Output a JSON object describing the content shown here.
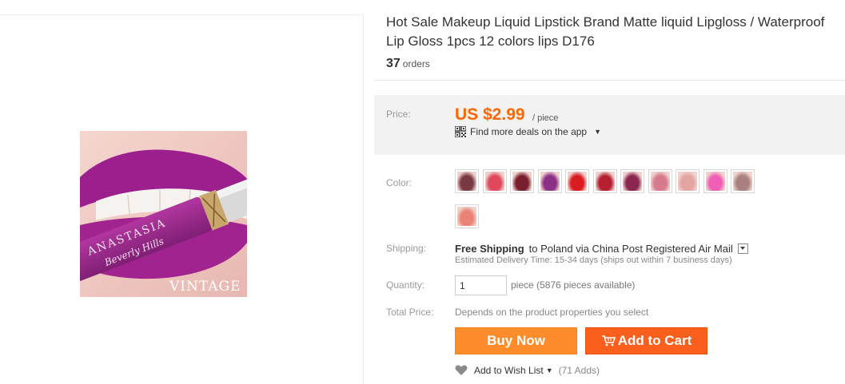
{
  "breadcrumb": {
    "text": ""
  },
  "product": {
    "title_line1": "Hot Sale Makeup Liquid Lipstick Brand Matte liquid Lipgloss / Waterproof",
    "title_line2": "Lip Gloss 1pcs 12 colors lips D176",
    "orders_count": "37",
    "orders_label": "orders",
    "image_text_brand": "ANASTASIA",
    "image_text_sub": "Beverly Hills",
    "image_text_shade": "VINTAGE"
  },
  "price": {
    "label": "Price:",
    "value": "US $2.99",
    "unit": "/ piece",
    "deals_text": "Find more deals on the app"
  },
  "color": {
    "label": "Color:",
    "swatches": [
      {
        "name": "model-1",
        "hex": "#7a3a44"
      },
      {
        "name": "pink-red",
        "hex": "#e0485e"
      },
      {
        "name": "wine",
        "hex": "#7a1e2e"
      },
      {
        "name": "purple",
        "hex": "#8c2f86"
      },
      {
        "name": "red",
        "hex": "#d91b22"
      },
      {
        "name": "model-2",
        "hex": "#b51f30"
      },
      {
        "name": "plum",
        "hex": "#8b2650"
      },
      {
        "name": "rose",
        "hex": "#d77a8e"
      },
      {
        "name": "nude-pink",
        "hex": "#e4a5a2"
      },
      {
        "name": "hot-pink",
        "hex": "#ef5fb6"
      },
      {
        "name": "mauve",
        "hex": "#a9817f"
      },
      {
        "name": "coral",
        "hex": "#ea8275"
      }
    ]
  },
  "shipping": {
    "label": "Shipping:",
    "free": "Free Shipping",
    "dest": "to  Poland via China Post Registered Air Mail",
    "estimate": "Estimated Delivery Time: 15-34 days (ships out within 7 business days)"
  },
  "quantity": {
    "label": "Quantity:",
    "value": "1",
    "available": "piece (5876 pieces available)"
  },
  "total": {
    "label": "Total Price:",
    "text": "Depends on the product properties you select"
  },
  "actions": {
    "buy_now": "Buy Now",
    "add_to_cart": "Add to Cart",
    "wishlist": "Add to Wish List",
    "wishlist_adds": "(71 Adds)"
  },
  "colors": {
    "accent_orange": "#ff6600",
    "buy_button": "#fd8d2b",
    "cart_button": "#fb5f1d",
    "price_bg": "#f2f2f2"
  }
}
